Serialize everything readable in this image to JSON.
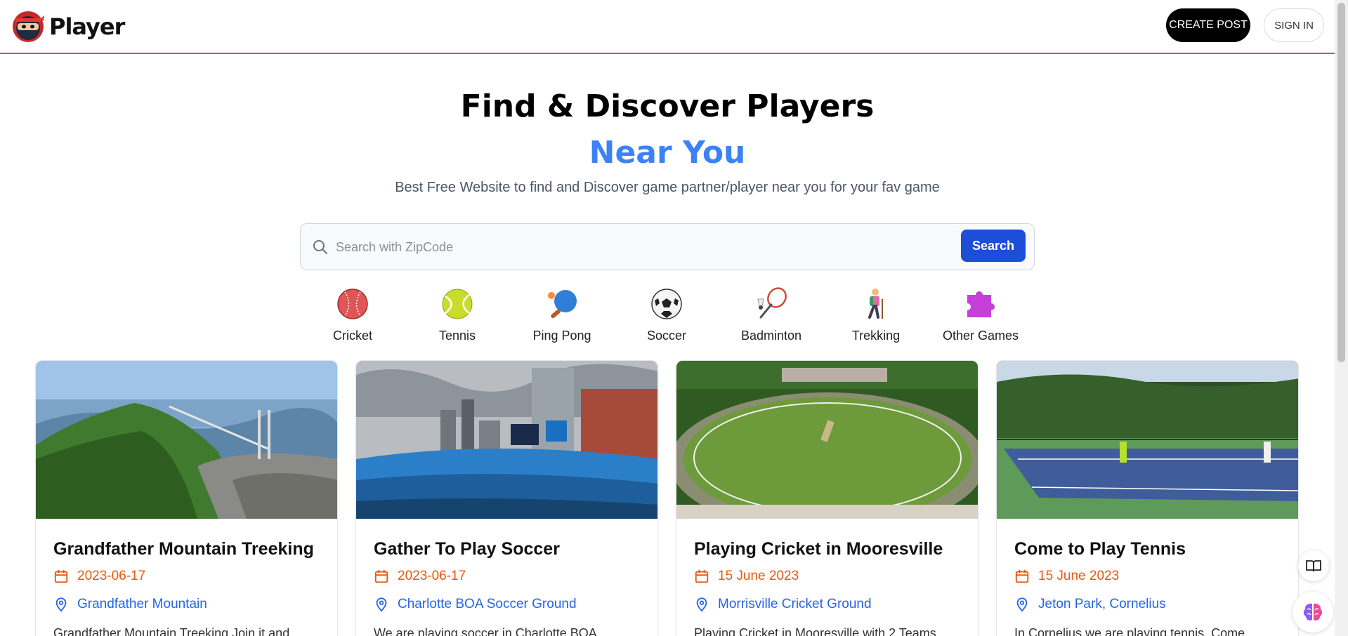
{
  "header": {
    "brand": "Player",
    "create_post_label": "CREATE POST",
    "sign_in_label": "SIGN IN",
    "accent_color": "#e0457b"
  },
  "hero": {
    "title": "Find & Discover Players",
    "subtitle": "Near You",
    "description": "Best Free Website to find and Discover game partner/player near you for your fav game",
    "subtitle_color": "#3b82f6"
  },
  "search": {
    "placeholder": "Search with ZipCode",
    "value": "",
    "button_label": "Search",
    "button_color": "#1d4ed8"
  },
  "categories": [
    {
      "label": "Cricket",
      "icon": "cricket-ball-icon"
    },
    {
      "label": "Tennis",
      "icon": "tennis-ball-icon"
    },
    {
      "label": "Ping Pong",
      "icon": "ping-pong-paddle-icon"
    },
    {
      "label": "Soccer",
      "icon": "soccer-ball-icon"
    },
    {
      "label": "Badminton",
      "icon": "badminton-icon"
    },
    {
      "label": "Trekking",
      "icon": "hiker-icon"
    },
    {
      "label": "Other Games",
      "icon": "puzzle-piece-icon"
    }
  ],
  "cards": [
    {
      "title": "Grandfather Mountain Treeking",
      "date": "2023-06-17",
      "location": "Grandfather Mountain",
      "description": "Grandfather Mountain Treeking Join it and",
      "image": "mountain-bridge-photo"
    },
    {
      "title": "Gather To Play Soccer",
      "date": "2023-06-17",
      "location": "Charlotte BOA Soccer Ground",
      "description": "We are playing soccer in Charlotte BOA",
      "image": "stadium-photo"
    },
    {
      "title": "Playing Cricket in Mooresville",
      "date": "15 June 2023",
      "location": "Morrisville Cricket Ground",
      "description": "Playing Cricket in Mooresville with 2 Teams",
      "image": "cricket-ground-photo"
    },
    {
      "title": "Come to Play Tennis",
      "date": "15 June 2023",
      "location": "Jeton Park, Cornelius",
      "description": "In Cornelius we are playing tennis. Come",
      "image": "tennis-court-photo"
    }
  ],
  "colors": {
    "date": "#ea580c",
    "location": "#2563eb"
  },
  "widgets": [
    {
      "icon": "book-icon"
    },
    {
      "icon": "brain-icon"
    }
  ]
}
